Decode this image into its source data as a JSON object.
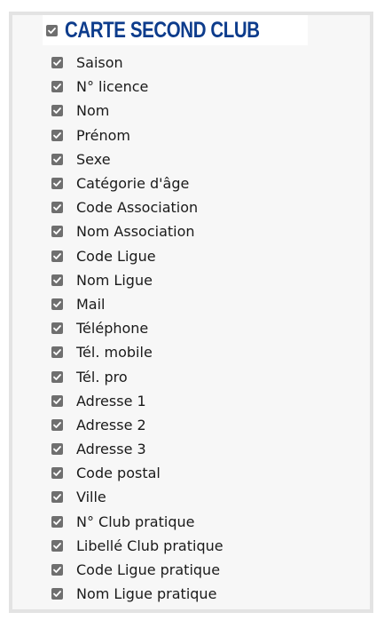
{
  "section": {
    "title": "CARTE SECOND CLUB",
    "checked": true
  },
  "items": [
    {
      "label": "Saison",
      "checked": true
    },
    {
      "label": "N° licence",
      "checked": true
    },
    {
      "label": "Nom",
      "checked": true
    },
    {
      "label": "Prénom",
      "checked": true
    },
    {
      "label": "Sexe",
      "checked": true
    },
    {
      "label": "Catégorie d'âge",
      "checked": true
    },
    {
      "label": "Code Association",
      "checked": true
    },
    {
      "label": "Nom Association",
      "checked": true
    },
    {
      "label": "Code Ligue",
      "checked": true
    },
    {
      "label": "Nom Ligue",
      "checked": true
    },
    {
      "label": "Mail",
      "checked": true
    },
    {
      "label": "Téléphone",
      "checked": true
    },
    {
      "label": "Tél. mobile",
      "checked": true
    },
    {
      "label": "Tél. pro",
      "checked": true
    },
    {
      "label": "Adresse 1",
      "checked": true
    },
    {
      "label": "Adresse 2",
      "checked": true
    },
    {
      "label": "Adresse 3",
      "checked": true
    },
    {
      "label": "Code postal",
      "checked": true
    },
    {
      "label": "Ville",
      "checked": true
    },
    {
      "label": "N° Club pratique",
      "checked": true
    },
    {
      "label": "Libellé Club pratique",
      "checked": true
    },
    {
      "label": "Code Ligue pratique",
      "checked": true
    },
    {
      "label": "Nom Ligue pratique",
      "checked": true
    }
  ],
  "colors": {
    "title": "#0d3c8c",
    "checkbox": "#6f6f6f",
    "panel_border": "#e3e3e3"
  }
}
